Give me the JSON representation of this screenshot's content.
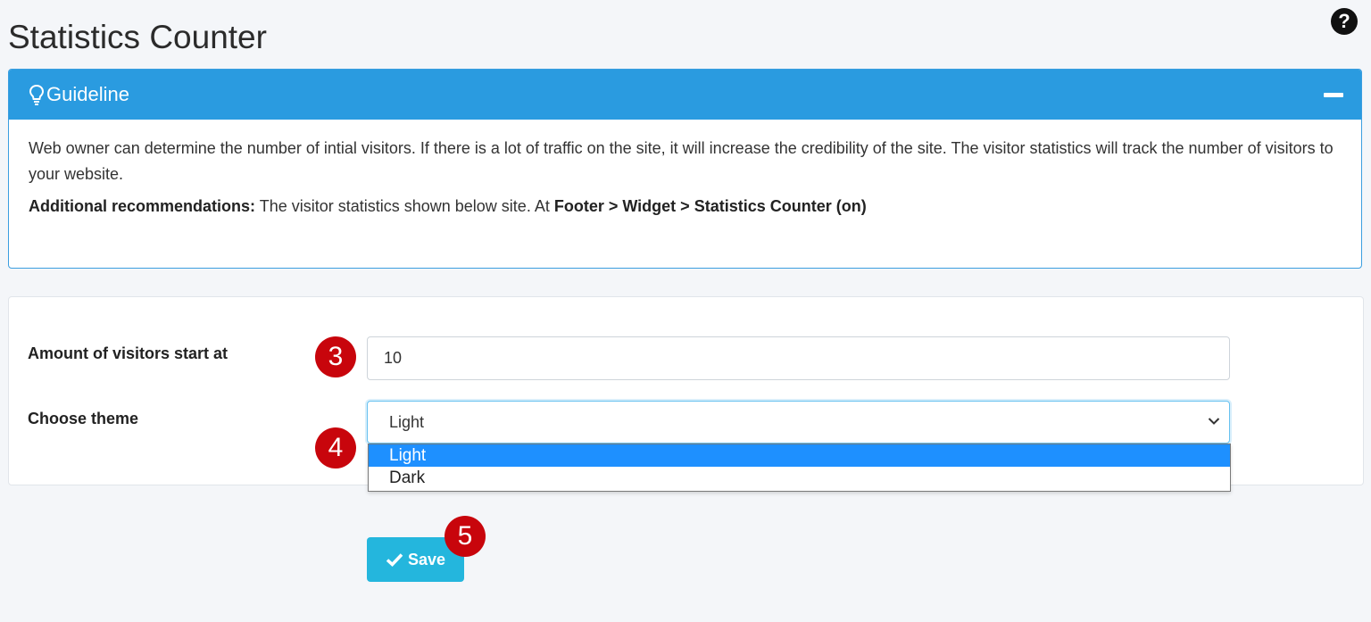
{
  "page": {
    "title": "Statistics Counter"
  },
  "help": {
    "glyph": "?"
  },
  "guideline": {
    "title": "Guideline",
    "paragraph": "Web owner can determine the number of intial visitors. If there is a lot of traffic on the site, it will increase the credibility of the site. The visitor statistics will track the number of visitors to your website.",
    "recommendation_label": "Additional recommendations:",
    "recommendation_text": " The visitor statistics shown below site. At ",
    "recommendation_path": "Footer > Widget > Statistics Counter (on)"
  },
  "form": {
    "visitors_label": "Amount of visitors start at",
    "visitors_value": "10",
    "theme_label": "Choose theme",
    "theme_selected": "Light",
    "theme_options": [
      "Light",
      "Dark"
    ]
  },
  "steps": {
    "three": "3",
    "four": "4",
    "five": "5"
  },
  "save": {
    "label": "Save"
  },
  "colors": {
    "header_blue": "#2a9be0",
    "badge_red": "#c8050c",
    "save_cyan": "#24b6dd",
    "option_highlight": "#1e90ff"
  },
  "icons": {
    "help": "question-circle-icon",
    "guideline": "lightbulb-icon",
    "collapse": "minus-icon",
    "select": "chevron-down-icon",
    "save": "check-icon"
  }
}
